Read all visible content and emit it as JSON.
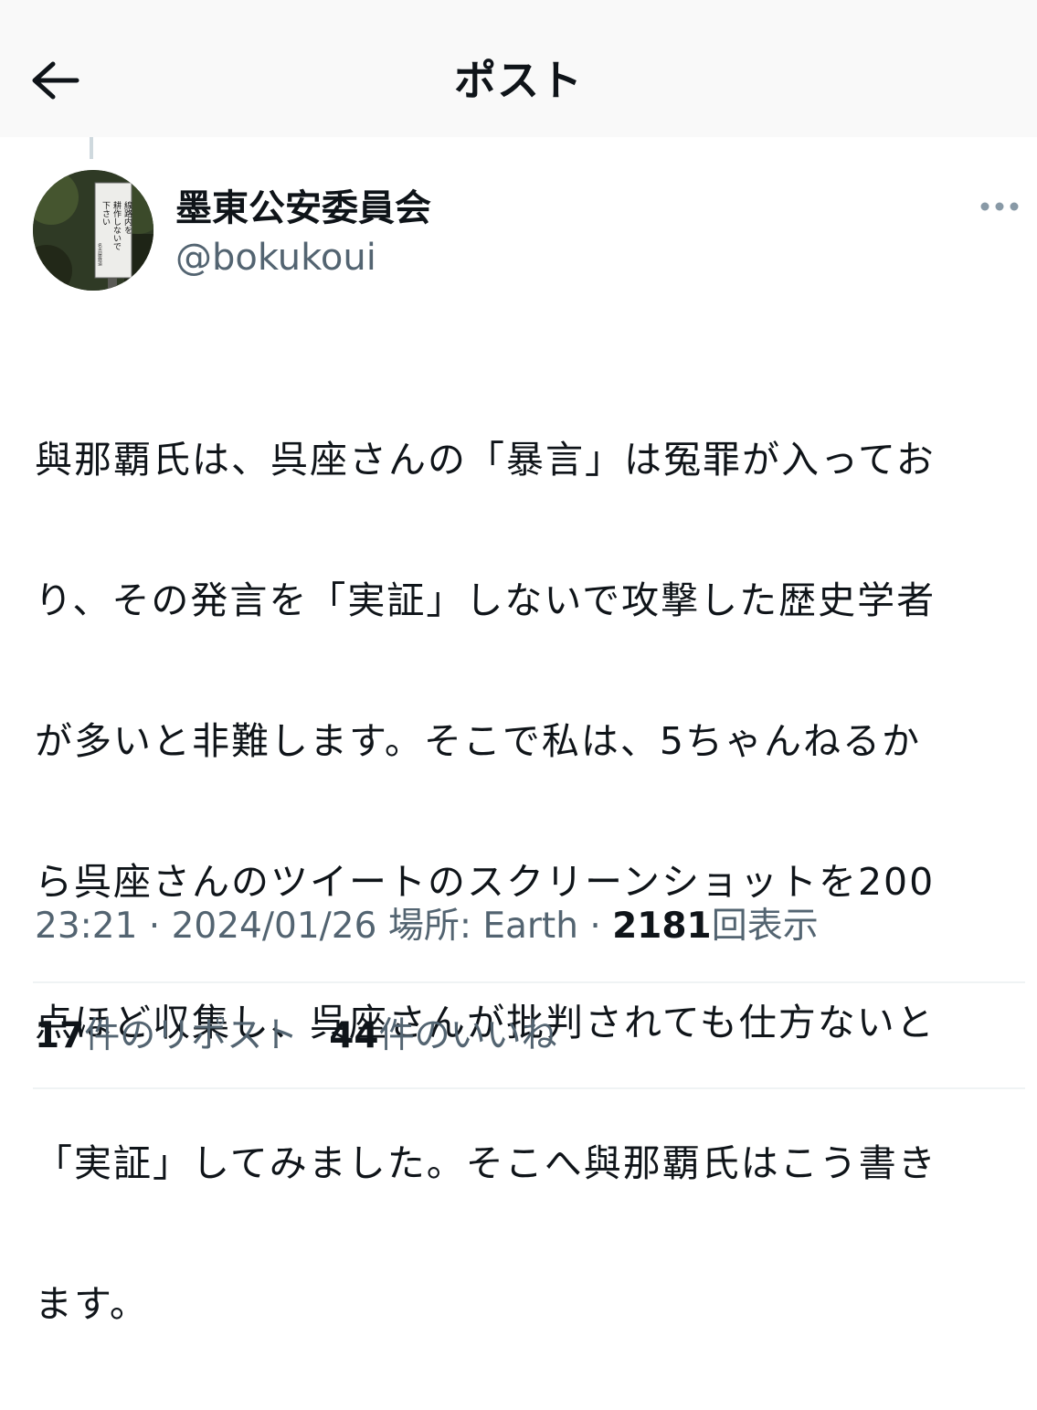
{
  "header": {
    "title": "ポスト",
    "back_icon": "arrow-left-icon"
  },
  "author": {
    "name": "墨東公安委員会",
    "handle": "@bokukoui",
    "avatar_sign_text": [
      "線路内を",
      "耕作しないで",
      "下さい",
      "名古屋鉄道"
    ]
  },
  "post": {
    "text": "與那覇氏は、呉座さんの「暴言」は冤罪が入っており、その発言を「実証」しないで攻撃した歴史学者が多いと非難します。そこで私は、5ちゃんねるから呉座さんのツイートのスクリーンショットを200点ほど収集し、呉座さんが批判されても仕方ないと「実証」してみました。そこへ與那覇氏はこう書きます。",
    "text_lines": [
      "與那覇氏は、呉座さんの「暴言」は冤罪が入ってお",
      "り、その発言を「実証」しないで攻撃した歴史学者",
      "が多いと非難します。そこで私は、5ちゃんねるか",
      "ら呉座さんのツイートのスクリーンショットを200",
      "点ほど収集し、呉座さんが批判されても仕方ないと",
      "「実証」してみました。そこへ與那覇氏はこう書き",
      "ます。"
    ]
  },
  "meta": {
    "time": "23:21",
    "separator": " · ",
    "date": "2024/01/26",
    "location_label": "場所: Earth",
    "views_count": "2181",
    "views_label": "回表示"
  },
  "stats": {
    "reposts_count": "17",
    "reposts_label": "件のリポスト",
    "likes_count": "44",
    "likes_label": "件のいいね"
  },
  "colors": {
    "text": "#0f1419",
    "secondary": "#536471",
    "divider": "#eff3f4",
    "header_bg": "#f9f9f9"
  }
}
